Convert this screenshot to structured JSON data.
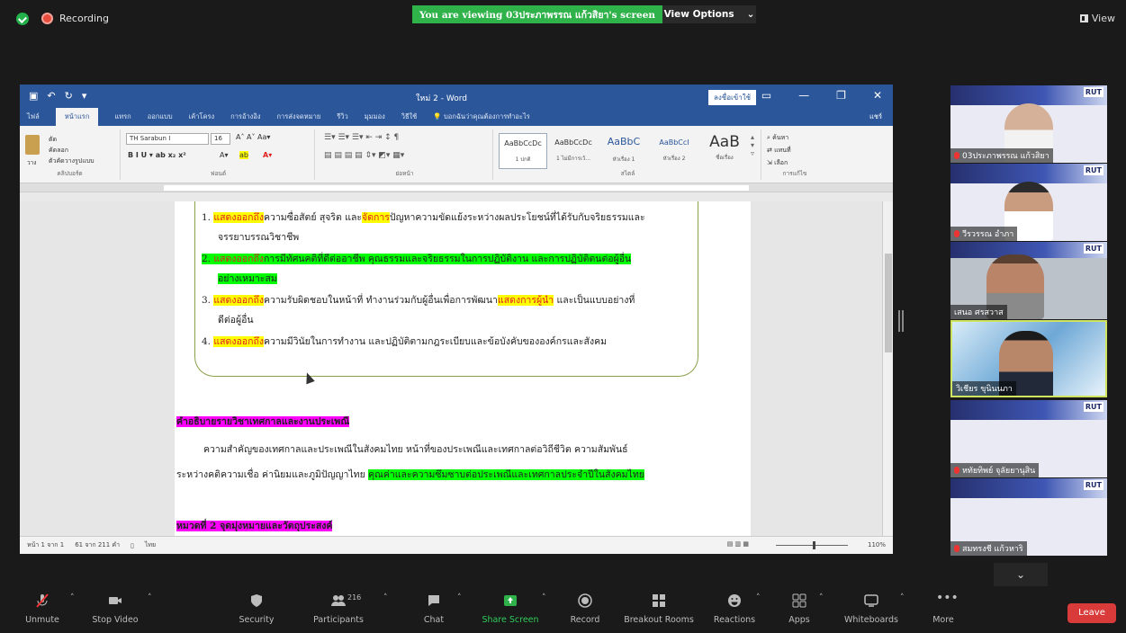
{
  "zoom": {
    "recording_label": "Recording",
    "viewing_banner": "You are viewing 03ประภาพรรณ แก้วสิยา's screen",
    "view_options_label": "View Options",
    "view_label": "View",
    "leave_label": "Leave"
  },
  "word": {
    "title": "ใหม่ 2 - Word",
    "signin_label": "ลงชื่อเข้าใช้",
    "tabs": [
      "ไฟล์",
      "หน้าแรก",
      "แทรก",
      "ออกแบบ",
      "เค้าโครง",
      "การอ้างอิง",
      "การส่งจดหมาย",
      "รีวิว",
      "มุมมอง",
      "วิธีใช้",
      "บอกฉันว่าคุณต้องการทำอะไร"
    ],
    "share_label": "แชร์",
    "ribbon": {
      "paste_label": "วาง",
      "cut_label": "ตัด",
      "copy_label": "คัดลอก",
      "format_painter_label": "ตัวคัดวางรูปแบบ",
      "clipboard_label": "คลิปบอร์ด",
      "font_name": "TH Sarabun I",
      "font_size": "16",
      "font_group_label": "ฟอนต์",
      "paragraph_group_label": "ย่อหน้า",
      "styles_group_label": "สไตล์",
      "styles": [
        {
          "sample": "AaBbCcDc",
          "name": "1 ปกติ"
        },
        {
          "sample": "AaBbCcDc",
          "name": "1 ไม่มีการเว้..."
        },
        {
          "sample": "AaBbC",
          "name": "หัวเรื่อง 1"
        },
        {
          "sample": "AaBbCcI",
          "name": "หัวเรื่อง 2"
        },
        {
          "sample": "AaB",
          "name": "ชื่อเรื่อง"
        }
      ],
      "find_label": "ค้นหา",
      "replace_label": "แทนที่",
      "select_label": "เลือก",
      "editing_group_label": "การแก้ไข"
    },
    "doc": {
      "items": [
        {
          "num": "1.",
          "hl": "แสดงออกถึง",
          "t1": "ความซื่อสัตย์ สุจริต และ",
          "hl2": "จัดการ",
          "t2": "ปัญหาความขัดแย้งระหว่างผลประโยชน์ที่ได้รับกับจริยธรรมและ",
          "line2": "จรรยาบรรณวิชาชีพ"
        },
        {
          "num": "2.",
          "hl": "แสดงออกถึง",
          "t1": "การมีทัศนคติที่ดีต่ออาชีพ คุณธรรมและจริยธรรมในการปฏิบัติงาน และการปฏิบัติตนต่อผู้อื่น",
          "line2": "อย่างเหมาะสม"
        },
        {
          "num": "3.",
          "hl": "แสดงออกถึง",
          "t1": "ความรับผิดชอบในหน้าที่ ทำงานร่วมกับผู้อื่นเพื่อการพัฒนา",
          "hl2": "แสดงการผู้นำ",
          "t2": " และเป็นแบบอย่างที่",
          "line2": "ดีต่อผู้อื่น"
        },
        {
          "num": "4.",
          "hl": "แสดงออกถึง",
          "t1": "ความมีวินัยในการทำงาน และปฏิบัติตามกฎระเบียบและข้อบังคับขององค์กรและสังคม"
        }
      ],
      "heading1": "คำอธิบายรายวิชาเทศกาลและงานประเพณี",
      "para_line1": "ความสำคัญของเทศกาลและประเพณีในสังคมไทย   หน้าที่ของประเพณีและเทศกาลต่อวิถีชีวิต   ความสัมพันธ์",
      "para_line2": "ระหว่างคติความเชื่อ ค่านิยมและภูมิปัญญาไทย",
      "para_line2_hl": "คุณค่าและความซึมซาบต่อประเพณีและเทศกาลประจำปีในสังคมไทย",
      "heading2": "หมวดที่ 2 จุดมุ่งหมายและวัตถุประสงค์"
    },
    "status": {
      "page": "หน้า 1 จาก 1",
      "words": "61 จาก 211 คำ",
      "lang": "ไทย",
      "zoom": "110%"
    }
  },
  "participants": [
    {
      "name": "03ประภาพรรณ แก้วสิยา",
      "type": "slide",
      "skin": "#d6b19a",
      "shirt": "#f2f2f2"
    },
    {
      "name": "วีรวรรณ อำภา",
      "type": "slide",
      "skin": "#c99c7f",
      "shirt": "#ffffff"
    },
    {
      "name": "เสนอ ศรสวาส",
      "type": "video",
      "skin": "#b98468",
      "shirt": "#8a8a8a"
    },
    {
      "name": "วิเชียร ขุนินนภา",
      "type": "video",
      "skin": "#b8876a",
      "shirt": "#222a3a"
    },
    {
      "name": "หทัยทิพย์ จุลัยยานุสิน",
      "type": "slide"
    },
    {
      "name": "สมทรงชี แก้วหาริ",
      "type": "slide"
    }
  ],
  "toolbar": {
    "unmute": "Unmute",
    "stop_video": "Stop Video",
    "security": "Security",
    "participants": "Participants",
    "participants_count": "216",
    "chat": "Chat",
    "share_screen": "Share Screen",
    "record": "Record",
    "breakout": "Breakout Rooms",
    "reactions": "Reactions",
    "apps": "Apps",
    "whiteboards": "Whiteboards",
    "more": "More"
  },
  "colors": {
    "word_blue": "#2b579a",
    "share_green": "#2fb24a",
    "leave_red": "#d93a3a",
    "highlight_yellow": "#ffff00",
    "highlight_green": "#00ff00",
    "highlight_magenta": "#ff00ff"
  }
}
